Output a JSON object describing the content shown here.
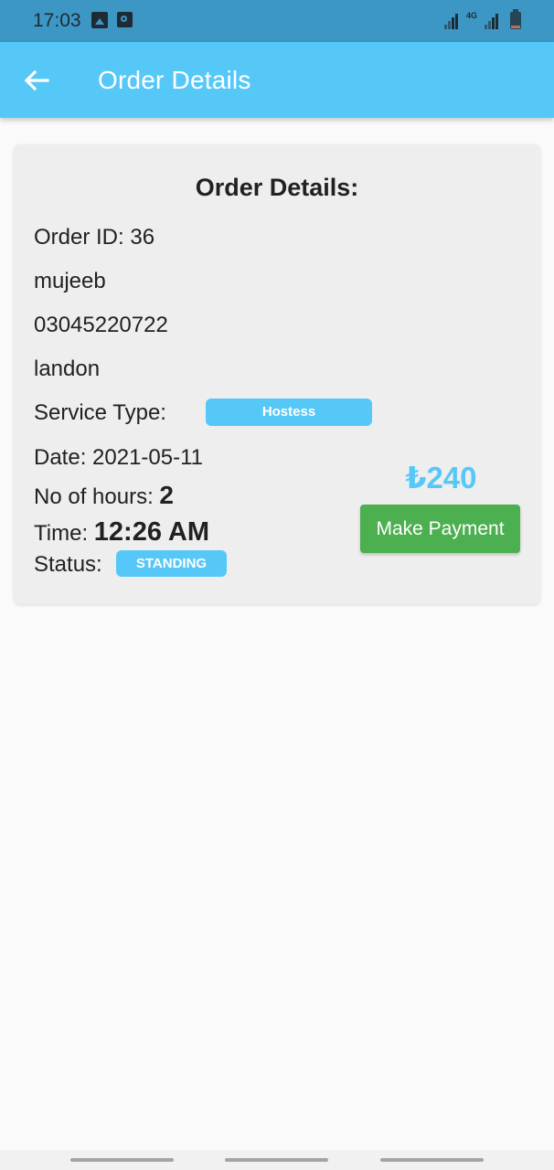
{
  "status_bar": {
    "time": "17:03",
    "icons": [
      "gallery-icon",
      "app-notification-icon",
      "signal-icon",
      "4g-icon",
      "signal-icon",
      "battery-icon"
    ],
    "network_label": "4G"
  },
  "app_bar": {
    "back_icon": "arrow-left-icon",
    "title": "Order Details"
  },
  "order": {
    "heading": "Order Details:",
    "order_id_line": "Order ID: 36",
    "customer_name": "mujeeb",
    "phone": "03045220722",
    "location": "landon",
    "service_type_label": "Service Type:",
    "service_type_value": "Hostess",
    "date_line": "Date: 2021-05-11",
    "hours_label": "No of hours:",
    "hours_value": "2",
    "time_label": "Time:",
    "time_value": "12:26 AM",
    "status_label": "Status:",
    "status_value": "STANDING",
    "price": "₺240",
    "pay_button_label": "Make Payment"
  },
  "colors": {
    "status_bar": "#3d97c4",
    "app_bar": "#56c8f8",
    "accent": "#56c8f8",
    "pay_button": "#4caf50",
    "card": "#eeeeee",
    "background": "#fafafa"
  }
}
